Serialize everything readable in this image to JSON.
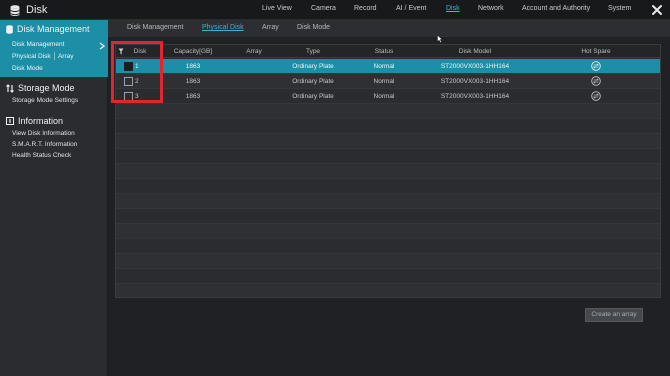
{
  "window": {
    "title": "Disk"
  },
  "topnav": [
    {
      "label": "Live View",
      "active": false
    },
    {
      "label": "Camera",
      "active": false
    },
    {
      "label": "Record",
      "active": false
    },
    {
      "label": "AI / Event",
      "active": false
    },
    {
      "label": "Disk",
      "active": true
    },
    {
      "label": "Network",
      "active": false
    },
    {
      "label": "Account and Authority",
      "active": false
    },
    {
      "label": "System",
      "active": false
    }
  ],
  "sidebar": {
    "groups": [
      {
        "label": "Disk Management",
        "items": [
          "Disk Management",
          "Physical Disk │ Array",
          "Disk Mode"
        ]
      },
      {
        "label": "Storage Mode",
        "items": [
          "Storage Mode Settings"
        ]
      },
      {
        "label": "Information",
        "items": [
          "View Disk Information",
          "S.M.A.R.T. Information",
          "Health Status Check"
        ]
      }
    ]
  },
  "subtabs": [
    {
      "label": "Disk Management",
      "active": false
    },
    {
      "label": "Physical Disk",
      "active": true
    },
    {
      "label": "Array",
      "active": false
    },
    {
      "label": "Disk Mode",
      "active": false
    }
  ],
  "table": {
    "columns": [
      "Disk",
      "Capacity[GB]",
      "Array",
      "Type",
      "Status",
      "Disk Model",
      "Hot Spare"
    ],
    "rows": [
      {
        "disk": "1",
        "capacity": "1863",
        "array": "",
        "type": "Ordinary Plate",
        "status": "Normal",
        "model": "ST2000VX003-1HH164",
        "selected": true
      },
      {
        "disk": "2",
        "capacity": "1863",
        "array": "",
        "type": "Ordinary Plate",
        "status": "Normal",
        "model": "ST2000VX003-1HH164",
        "selected": false
      },
      {
        "disk": "3",
        "capacity": "1863",
        "array": "",
        "type": "Ordinary Plate",
        "status": "Normal",
        "model": "ST2000VX003-1HH164",
        "selected": false
      }
    ]
  },
  "actions": {
    "create_array": "Create an array"
  },
  "colors": {
    "accent": "#1c8ea6",
    "link": "#3db3d6",
    "highlight": "#e0262f",
    "background": "#1f2124"
  },
  "icons": {
    "app": "database-icon",
    "close": "close-icon",
    "hot_spare": "swap-icon",
    "filter": "filter-icon"
  }
}
